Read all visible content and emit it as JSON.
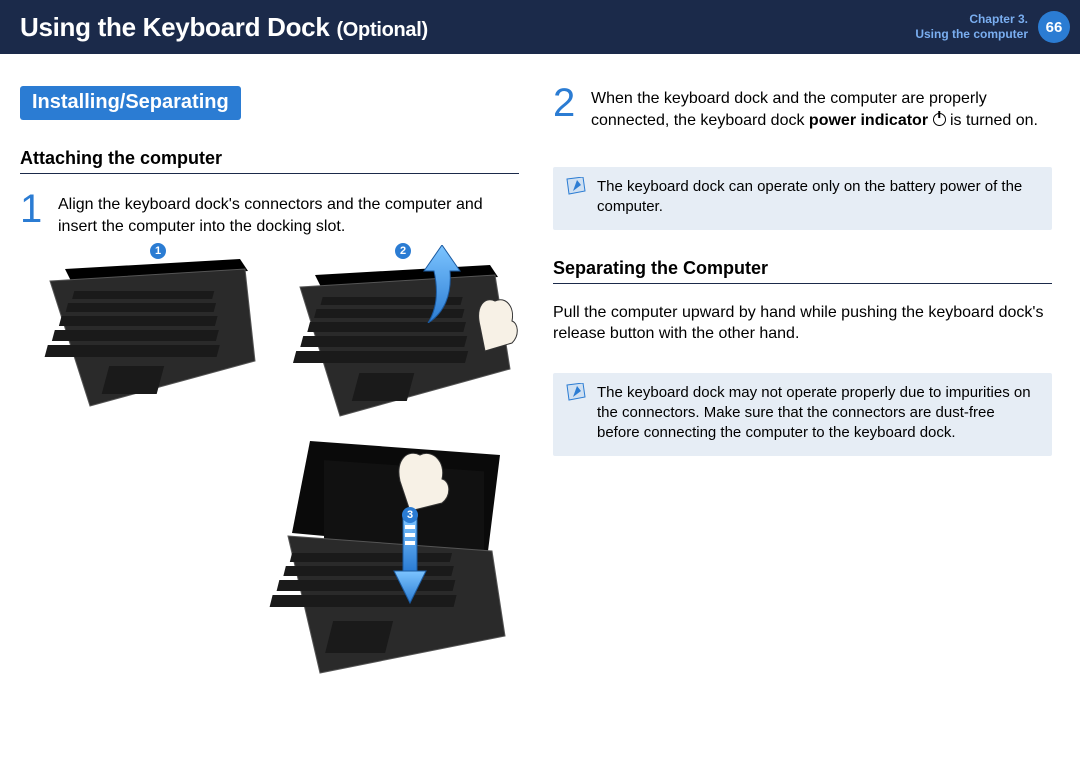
{
  "header": {
    "title_main": "Using the Keyboard Dock",
    "title_optional": "(Optional)",
    "chapter_line1": "Chapter 3.",
    "chapter_line2": "Using the computer",
    "page_num": "66"
  },
  "left": {
    "band": "Installing/Separating",
    "sub1": "Attaching the computer",
    "step1_num": "1",
    "step1_text": "Align the keyboard dock's connectors and the computer and insert the computer into the docking slot.",
    "callouts": {
      "one": "1",
      "two": "2",
      "three": "3"
    }
  },
  "right": {
    "step2_num": "2",
    "step2_text_a": "When the keyboard dock and the computer are properly connected, the keyboard dock ",
    "step2_bold": "power indicator",
    "step2_text_b": " is turned on.",
    "note1": "The keyboard dock can operate only on the battery power of the computer.",
    "sub2": "Separating the Computer",
    "sep_para": "Pull the computer upward by hand while pushing the keyboard dock's release button with the other hand.",
    "note2": "The keyboard dock may not operate properly due to impurities on the connectors. Make sure that the connectors are dust-free before connecting the computer to the keyboard dock."
  }
}
